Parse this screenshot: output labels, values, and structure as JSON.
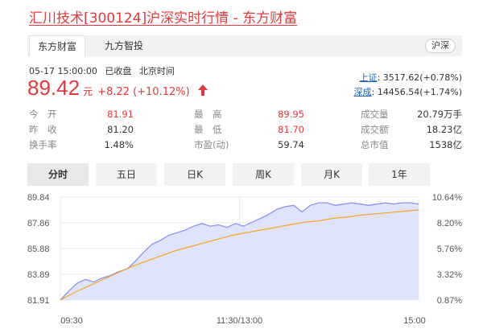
{
  "page": {
    "title": "汇川技术[300124]沪深实时行情 - 东方财富"
  },
  "tabs": {
    "items": [
      "东方财富",
      "九方智投"
    ],
    "market_badge": "沪深"
  },
  "status": {
    "datetime": "05-17 15:00:00",
    "state": "已收盘",
    "tz": "北京时间"
  },
  "quote": {
    "price": "89.42",
    "unit": "元",
    "change": "+8.22 (+10.12%)",
    "direction": "up"
  },
  "indices": [
    {
      "name": "上证",
      "value": ": 3517.62(+0.78%)"
    },
    {
      "name": "深成",
      "value": ": 14456.54(+1.74%)"
    }
  ],
  "stats": {
    "rows": [
      [
        {
          "label": "今　开",
          "value": "81.91",
          "color": "red"
        },
        {
          "label": "最　高",
          "value": "89.95",
          "color": "red"
        },
        {
          "label": "成交量",
          "value": "20.79万手",
          "color": "dark"
        }
      ],
      [
        {
          "label": "昨　收",
          "value": "81.20",
          "color": "dark"
        },
        {
          "label": "最　低",
          "value": "81.70",
          "color": "red"
        },
        {
          "label": "成交额",
          "value": "18.23亿",
          "color": "dark"
        }
      ],
      [
        {
          "label": "换手率",
          "value": "1.48%",
          "color": "dark"
        },
        {
          "label": "市盈(动)",
          "value": "59.74",
          "color": "dark"
        },
        {
          "label": "总市值",
          "value": "1538亿",
          "color": "dark"
        }
      ]
    ]
  },
  "periods": {
    "items": [
      "分时",
      "五日",
      "日K",
      "周K",
      "月K",
      "1年"
    ],
    "active_index": 0
  },
  "chart_data": {
    "type": "area",
    "y_ticks_price": [
      "89.84",
      "87.86",
      "85.88",
      "83.89",
      "81.91"
    ],
    "y_ticks_pct": [
      "10.64%",
      "8.20%",
      "5.76%",
      "3.32%",
      "0.87%"
    ],
    "x_ticks": [
      "09:30",
      "11:30/13:00",
      "15:00"
    ],
    "ylim": [
      81.91,
      89.84
    ],
    "series": [
      {
        "values": [
          81.91,
          82.6,
          83.2,
          83.5,
          83.3,
          83.6,
          83.8,
          84.1,
          84.3,
          84.9,
          85.6,
          86.2,
          86.5,
          86.9,
          87.1,
          87.3,
          87.6,
          87.8,
          87.6,
          87.7,
          87.5,
          87.8,
          87.6,
          87.9,
          88.2,
          88.5,
          88.9,
          89.1,
          89.2,
          88.7,
          89.2,
          89.4,
          89.4,
          89.2,
          89.3,
          89.4,
          89.3,
          89.2,
          89.3,
          89.4,
          89.3,
          89.4,
          89.4,
          89.3
        ]
      },
      {
        "values": [
          81.91,
          82.5,
          83.0,
          83.5,
          84.0,
          84.5,
          84.9,
          85.3,
          85.7,
          86.0,
          86.3,
          86.6,
          86.9,
          87.1,
          87.3,
          87.5,
          87.7,
          87.9,
          88.0,
          88.2,
          88.3,
          88.45,
          88.55,
          88.65,
          88.75,
          88.85
        ]
      }
    ],
    "colors": {
      "price": "#8a94f0",
      "fill": "#dfe3fb",
      "avg": "#f5a623",
      "grid": "#e8e8e8"
    }
  }
}
